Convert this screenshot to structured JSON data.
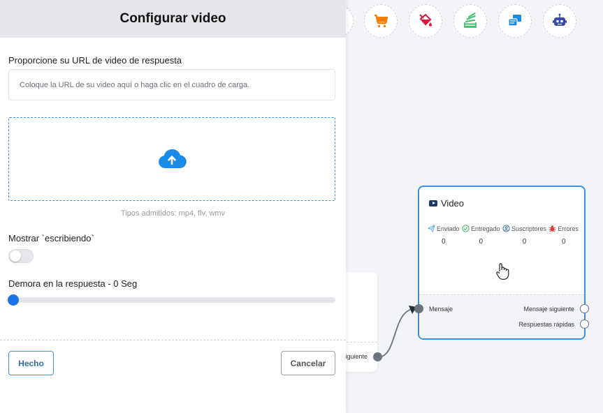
{
  "panel": {
    "title": "Configurar video",
    "url_label": "Proporcione su URL de video de respuesta",
    "url_placeholder": "Coloque la URL de su video aquí o haga clic en el cuadro de carga.",
    "url_value": "",
    "types_hint": "Tipos admitidos: mp4, flv, wmv",
    "typing_label": "Mostrar `escribiendo`",
    "typing_enabled": false,
    "delay_label": "Demora en la respuesta  -  0 Seg",
    "delay_value": 0,
    "done_button": "Hecho",
    "cancel_button": "Cancelar"
  },
  "toolbar": {
    "icons": [
      "shopping-cart-icon",
      "paint-bucket-icon",
      "stack-icon",
      "message-cards-icon",
      "robot-icon"
    ],
    "colors": [
      "#f57c00",
      "#d81b3a",
      "#43c06a",
      "#1e88e5",
      "#3949ab"
    ]
  },
  "prev_node": {
    "output_label": "siguiente"
  },
  "node": {
    "title": "Video",
    "stats": [
      {
        "label": "Enviado",
        "value": "0"
      },
      {
        "label": "Entregado",
        "value": "0"
      },
      {
        "label": "Suscriptores",
        "value": "0"
      },
      {
        "label": "Errores",
        "value": "0"
      }
    ],
    "input_label": "Mensaje",
    "outputs": [
      "Mensaje siguiente",
      "Respuestas rápidas"
    ]
  },
  "colors": {
    "accent": "#3b8fe0",
    "slider": "#1a73e8"
  }
}
